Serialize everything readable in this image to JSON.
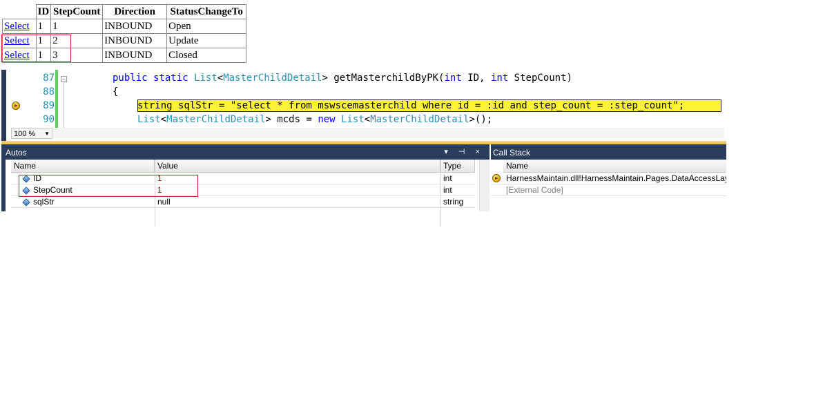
{
  "grid": {
    "headers": [
      "ID",
      "StepCount",
      "Direction",
      "StatusChangeTo"
    ],
    "select_label": "Select",
    "rows": [
      {
        "id": "1",
        "step": "1",
        "direction": "INBOUND",
        "status": "Open"
      },
      {
        "id": "1",
        "step": "2",
        "direction": "INBOUND",
        "status": "Update"
      },
      {
        "id": "1",
        "step": "3",
        "direction": "INBOUND",
        "status": "Closed"
      }
    ]
  },
  "editor": {
    "lines": [
      {
        "number": "87"
      },
      {
        "number": "88"
      },
      {
        "number": "89"
      },
      {
        "number": "90"
      }
    ],
    "code": {
      "l87": {
        "kw1": "public",
        "kw2": "static",
        "ty1": "List",
        "lt": "<",
        "ty2": "MasterChildDetail",
        "rest1": "> getMasterchildByPK(",
        "kw3": "int",
        "rest2": " ID, ",
        "kw4": "int",
        "rest3": " StepCount)"
      },
      "l88": "{",
      "l89": "string sqlStr = \"select * from mswscemasterchild where id = :id and step_count = :step_count\";",
      "l90": {
        "ty1": "List",
        "lt": "<",
        "ty2": "MasterChildDetail",
        "rest1": "> mcds = ",
        "kw1": "new",
        "sp": " ",
        "ty3": "List",
        "lt2": "<",
        "ty4": "MasterChildDetail",
        "rest2": ">();"
      }
    },
    "zoom": "100 %",
    "highlight_color": "#fff23a",
    "line_number_color": "#2b91af"
  },
  "autos": {
    "title": "Autos",
    "columns": [
      "Name",
      "Value",
      "Type"
    ],
    "rows": [
      {
        "name": "ID",
        "value": "1",
        "type": "int"
      },
      {
        "name": "StepCount",
        "value": "1",
        "type": "int"
      },
      {
        "name": "sqlStr",
        "value": "null",
        "type": "string"
      }
    ],
    "pane_buttons": "▾ ⊣ ×"
  },
  "callstack": {
    "title": "Call Stack",
    "column": "Name",
    "rows": [
      {
        "name": "HarnessMaintain.dll!HarnessMaintain.Pages.DataAccessLaye"
      },
      {
        "name": "[External Code]"
      }
    ]
  },
  "colors": {
    "toolwindow_header": "#2b3d5c",
    "annotation_red": "#c0262e",
    "changed_value": "#c00000"
  }
}
